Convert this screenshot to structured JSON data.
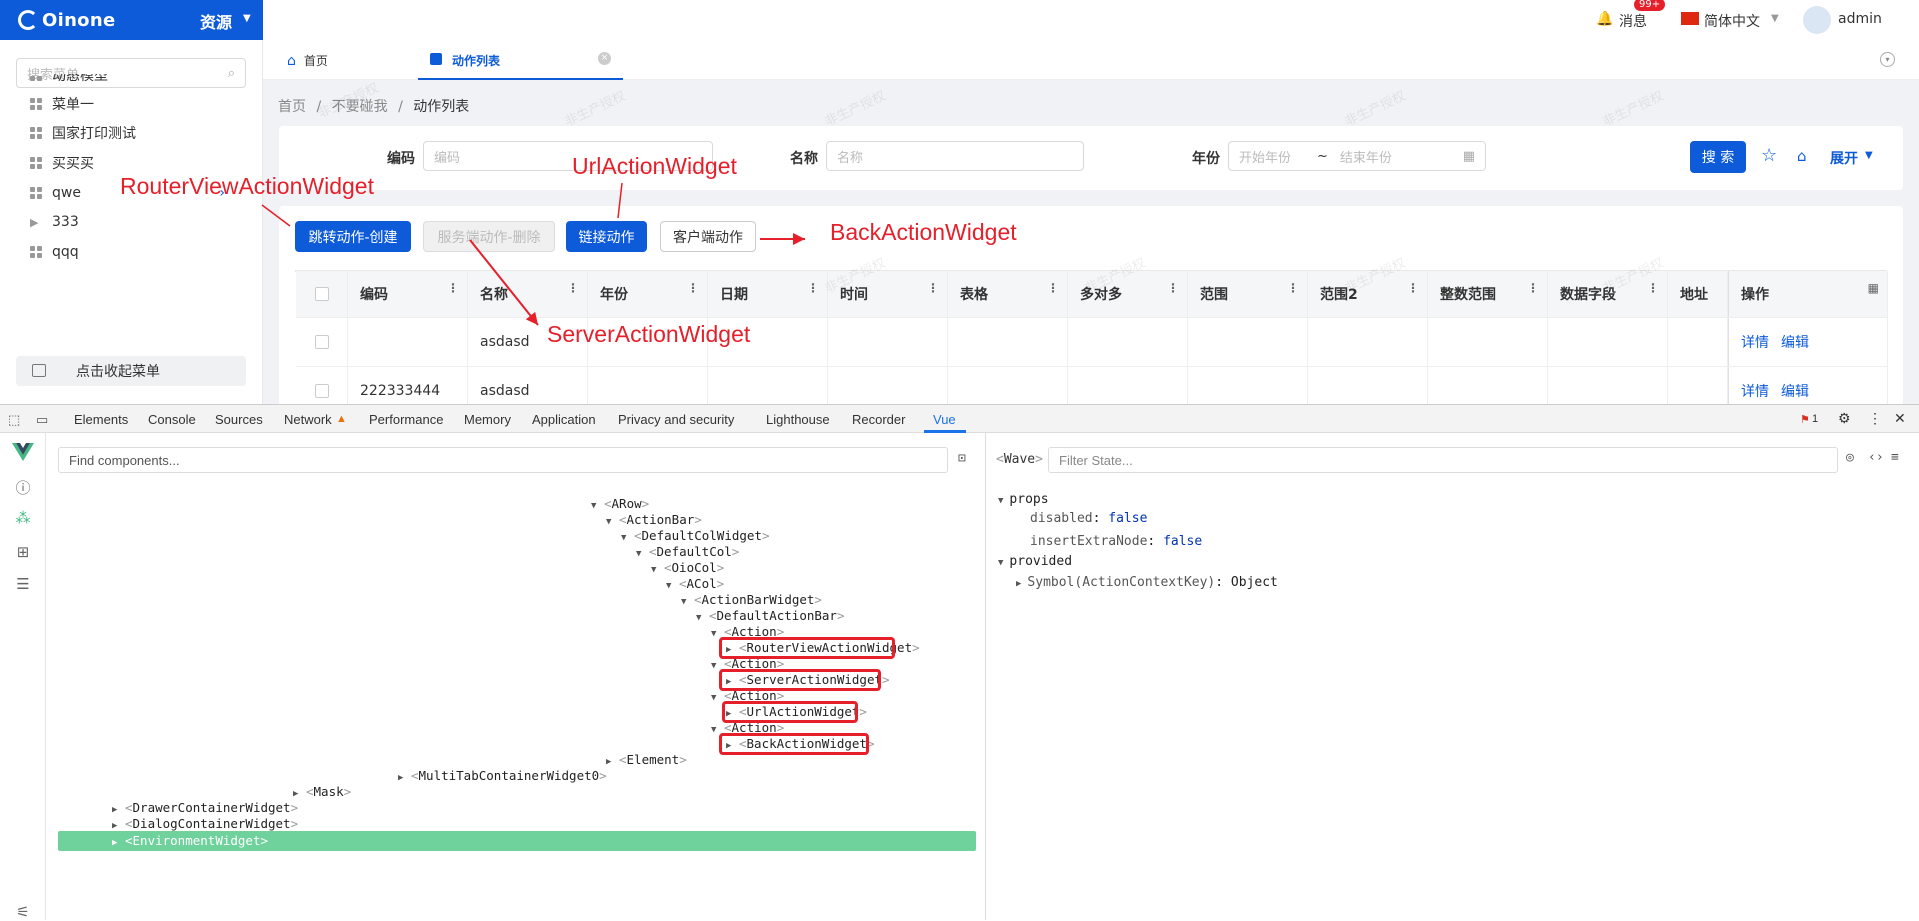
{
  "app": {
    "brand": "Oinone",
    "resource_label": "资源",
    "menu_search_placeholder": "搜索菜单",
    "menu_items": [
      "动态模型",
      "菜单一",
      "国家打印测试",
      "买买买",
      "qwe",
      "333",
      "qqq"
    ],
    "collapse_label": "点击收起菜单",
    "topbar": {
      "messages_label": "消息",
      "messages_badge": "99+",
      "language": "简体中文",
      "user": "admin"
    },
    "tabs": [
      {
        "label": "首页"
      },
      {
        "label": "动作列表"
      }
    ],
    "breadcrumb": [
      "首页",
      "不要碰我",
      "动作列表"
    ],
    "search": {
      "code_label": "编码",
      "code_placeholder": "编码",
      "name_label": "名称",
      "name_placeholder": "名称",
      "year_label": "年份",
      "year_start_placeholder": "开始年份",
      "year_sep": "~",
      "year_end_placeholder": "结束年份",
      "search_button": "搜 索",
      "expand_label": "展开"
    },
    "actions": [
      "跳转动作-创建",
      "服务端动作-删除",
      "链接动作",
      "客户端动作"
    ],
    "table": {
      "columns": [
        "编码",
        "名称",
        "年份",
        "日期",
        "时间",
        "表格",
        "多对多",
        "范围",
        "范围2",
        "整数范围",
        "数据字段",
        "地址",
        "操作"
      ],
      "rows": [
        {
          "code": "",
          "name": "asdasd",
          "ops": [
            "详情",
            "编辑"
          ]
        },
        {
          "code": "222333444",
          "name": "asdasd",
          "ops": [
            "详情",
            "编辑"
          ]
        }
      ]
    },
    "watermark": "非生产授权"
  },
  "annotations": [
    "RouterViewActionWidget",
    "UrlActionWidget",
    "BackActionWidget",
    "ServerActionWidget"
  ],
  "devtools": {
    "tabs": [
      "Elements",
      "Console",
      "Sources",
      "Network",
      "Performance",
      "Memory",
      "Application",
      "Privacy and security",
      "Lighthouse",
      "Recorder",
      "Vue"
    ],
    "active_tab": "Vue",
    "issues_count": "1",
    "find_placeholder": "Find components...",
    "tree": [
      "ARow",
      "ActionBar",
      "DefaultColWidget",
      "DefaultCol",
      "OioCol",
      "ACol",
      "ActionBarWidget",
      "DefaultActionBar",
      "Action",
      "RouterViewActionWidget",
      "Action",
      "ServerActionWidget",
      "Action",
      "UrlActionWidget",
      "Action",
      "BackActionWidget",
      "Element",
      "MultiTabContainerWidget0",
      "Mask",
      "DrawerContainerWidget",
      "DialogContainerWidget",
      "EnvironmentWidget"
    ],
    "selected_component": "Wave",
    "filter_placeholder": "Filter State...",
    "state": {
      "props_label": "props",
      "props": [
        {
          "key": "disabled",
          "value": "false"
        },
        {
          "key": "insertExtraNode",
          "value": "false"
        }
      ],
      "provided_label": "provided",
      "provided": [
        {
          "key": "Symbol(ActionContextKey)",
          "value": "Object"
        }
      ]
    }
  }
}
